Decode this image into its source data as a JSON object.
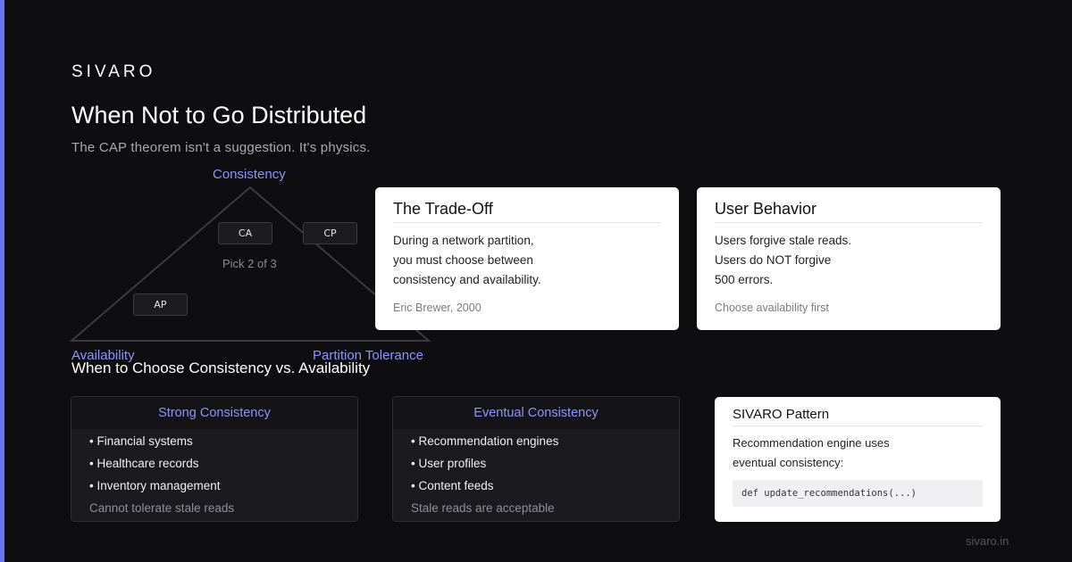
{
  "brand": "SIVARO",
  "title": "When Not to Go Distributed",
  "subtitle": "The CAP theorem isn't a suggestion. It's physics.",
  "triangle": {
    "top_label": "Consistency",
    "left_label": "Availability",
    "right_label": "Partition Tolerance",
    "pills": {
      "ca": "CA",
      "cp": "CP",
      "ap": "AP"
    },
    "center_text": "Pick 2 of 3"
  },
  "tradeoff_card": {
    "title": "The Trade-Off",
    "lines": [
      "During a network partition,",
      "you must choose between",
      "consistency and availability."
    ],
    "footnote": "Eric Brewer, 2000"
  },
  "behavior_card": {
    "title": "User Behavior",
    "lines": [
      "Users forgive stale reads.",
      "Users do NOT forgive",
      "500 errors."
    ],
    "footnote": "Choose availability first"
  },
  "section_heading": "When to Choose Consistency vs. Availability",
  "strong_card": {
    "title": "Strong Consistency",
    "items": [
      "• Financial systems",
      "• Healthcare records",
      "• Inventory management"
    ],
    "note": "Cannot tolerate stale reads"
  },
  "eventual_card": {
    "title": "Eventual Consistency",
    "items": [
      "• Recommendation engines",
      "• User profiles",
      "• Content feeds"
    ],
    "note": "Stale reads are acceptable"
  },
  "pattern_card": {
    "title": "SIVARO Pattern",
    "lines": [
      "Recommendation engine uses",
      "eventual consistency:"
    ],
    "code": "def update_recommendations(...)"
  },
  "footer": "sivaro.in",
  "colors": {
    "accent": "#6b72f0",
    "label_accent": "#8c93ff",
    "background": "#0e0e10"
  }
}
